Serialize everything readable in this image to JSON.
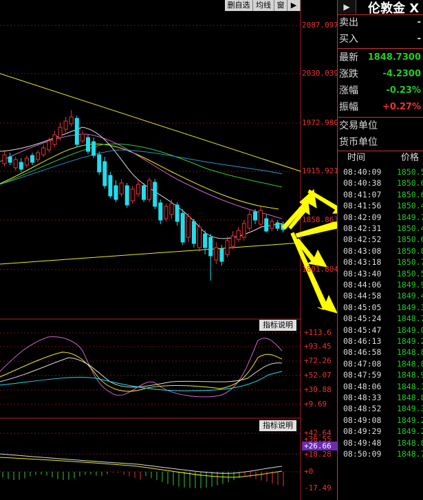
{
  "toolbar": {
    "buttons": [
      "删自选",
      "均线",
      "窗"
    ],
    "icon": "arrow-right-icon"
  },
  "main_axis": {
    "labels": [
      "2087.097",
      "2030.039",
      "1972.980",
      "1915.921",
      "1858.863",
      "1801.804"
    ]
  },
  "indicator1": {
    "button": "指标说明",
    "labels": [
      "+113.6",
      "+93.45",
      "+72.26",
      "+52.07",
      "+30.88",
      "+9.69"
    ]
  },
  "indicator2": {
    "button": "指标说明",
    "labels": [
      "+42.64",
      "+36.55",
      "+26.66",
      "+18.28",
      "+0",
      "-17.49"
    ]
  },
  "panel": {
    "title": "伦敦金 X",
    "rows": [
      {
        "label": "卖出",
        "value": "-"
      },
      {
        "label": "买入",
        "value": "-"
      }
    ],
    "quotes": [
      {
        "label": "最新",
        "value": "1848.7300",
        "color": "#2c2"
      },
      {
        "label": "涨跌",
        "value": "-4.2300",
        "color": "#2c2"
      },
      {
        "label": "涨幅",
        "value": "-0.23%",
        "color": "#2c2"
      },
      {
        "label": "振幅",
        "value": "+0.27%",
        "color": "#e33"
      }
    ],
    "info": [
      "交易单位",
      "货币单位"
    ],
    "table_headers": {
      "time": "时间",
      "price": "价格"
    },
    "ticks": [
      {
        "time": "08:40:09",
        "price": "1850.5"
      },
      {
        "time": "08:40:38",
        "price": "1850.6"
      },
      {
        "time": "08:41:07",
        "price": "1850.6"
      },
      {
        "time": "08:41:56",
        "price": "1850.4"
      },
      {
        "time": "08:42:09",
        "price": "1849.7"
      },
      {
        "time": "08:42:31",
        "price": "1850.4"
      },
      {
        "time": "08:42:52",
        "price": "1850.6"
      },
      {
        "time": "08:43:08",
        "price": "1850.8"
      },
      {
        "time": "08:43:18",
        "price": "1850.7"
      },
      {
        "time": "08:43:40",
        "price": "1850.5"
      },
      {
        "time": "08:44:06",
        "price": "1849.9"
      },
      {
        "time": "08:44:58",
        "price": "1849.4"
      },
      {
        "time": "08:45:05",
        "price": "1849.3"
      },
      {
        "time": "08:45:24",
        "price": "1848.7"
      },
      {
        "time": "08:45:47",
        "price": "1849.0"
      },
      {
        "time": "08:46:13",
        "price": "1849.2"
      },
      {
        "time": "08:46:58",
        "price": "1848.8"
      },
      {
        "time": "08:47:08",
        "price": "1848.8"
      },
      {
        "time": "08:47:59",
        "price": "1848.9"
      },
      {
        "time": "08:48:06",
        "price": "1848.1"
      },
      {
        "time": "08:48:33",
        "price": "1848.8"
      },
      {
        "time": "08:48:52",
        "price": "1849.3"
      },
      {
        "time": "08:49:08",
        "price": "1849.2"
      },
      {
        "time": "08:49:29",
        "price": "1849.2"
      },
      {
        "time": "08:49:48",
        "price": "1848.8"
      },
      {
        "time": "08:50:09",
        "price": "1848.7"
      }
    ]
  },
  "colors": {
    "up": "#e33",
    "down": "#2de",
    "axis": "#e33",
    "price_green": "#2c2"
  }
}
